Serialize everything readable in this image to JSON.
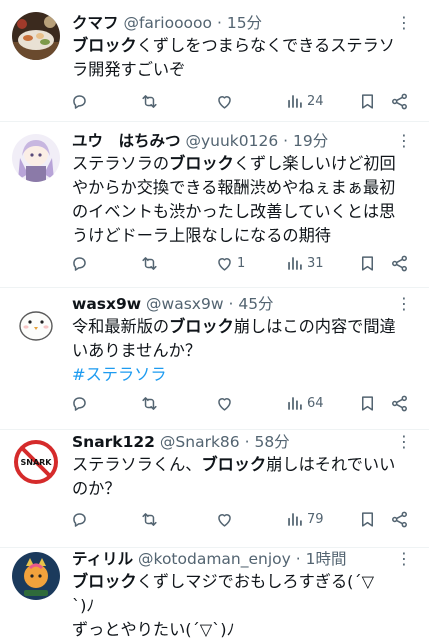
{
  "tweets": [
    {
      "name": "クマフ",
      "handle": "@fariooooo",
      "sep": "·",
      "time": "15分",
      "body": [
        [
          {
            "t": "ブロック",
            "b": true
          },
          {
            "t": "くずしをつまらなくできるステラソ"
          }
        ],
        [
          {
            "t": "ラ開発すごいぞ"
          }
        ]
      ],
      "likes": "",
      "views": "24"
    },
    {
      "name": "ユウ　はちみつ",
      "handle": "@yuuk0126",
      "sep": "·",
      "time": "19分",
      "body": [
        [
          {
            "t": "ステラソラの"
          },
          {
            "t": "ブロック",
            "b": true
          },
          {
            "t": "くずし楽しいけど初回"
          }
        ],
        [
          {
            "t": "やからか交換できる報酬渋めやねぇまぁ最初"
          }
        ],
        [
          {
            "t": "のイベントも渋かったし改善していくとは思"
          }
        ],
        [
          {
            "t": "うけどドーラ上限なしになるの期待"
          }
        ]
      ],
      "likes": "1",
      "views": "31"
    },
    {
      "name": "wasx9w",
      "handle": "@wasx9w",
      "sep": "·",
      "time": "45分",
      "body": [
        [
          {
            "t": "令和最新版の"
          },
          {
            "t": "ブロック",
            "b": true
          },
          {
            "t": "崩しはこの内容で間違"
          }
        ],
        [
          {
            "t": "いありませんか？"
          }
        ],
        [
          {
            "t": "#ステラソラ",
            "tag": true
          }
        ]
      ],
      "likes": "",
      "views": "64"
    },
    {
      "name": "Snark122",
      "handle": "@Snark86",
      "sep": "·",
      "time": "58分",
      "avatar_text": "SNARK",
      "body": [
        [
          {
            "t": "ステラソラくん、"
          },
          {
            "t": "ブロック",
            "b": true
          },
          {
            "t": "崩しはそれでいい"
          }
        ],
        [
          {
            "t": "のか？"
          }
        ]
      ],
      "likes": "",
      "views": "79"
    },
    {
      "name": "ティリル",
      "handle": "@kotodaman_enjoy",
      "sep": "·",
      "time": "1時間",
      "body": [
        [
          {
            "t": "ブロック",
            "b": true
          },
          {
            "t": "くずしマジでおもしろすぎる(´▽"
          }
        ],
        [
          {
            "t": "`)ﾉ"
          }
        ],
        [
          {
            "t": "ずっとやりたい(´▽`)ﾉ"
          }
        ]
      ],
      "likes": "",
      "views": ""
    }
  ],
  "icons": {
    "reply": "reply-icon",
    "retweet": "retweet-icon",
    "like": "heart-icon",
    "views": "views-chart-icon",
    "bookmark": "bookmark-icon",
    "share": "share-icon",
    "more": "more-icon"
  },
  "colors": {
    "text": "#0f1419",
    "muted": "#536471",
    "hashtag": "#1d9bf0",
    "divider": "#eff3f4",
    "snark_red": "#d52b2b"
  }
}
